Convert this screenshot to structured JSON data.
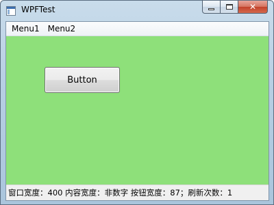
{
  "window": {
    "title": "WPFTest",
    "icon": "app-window-icon",
    "controls": {
      "minimize_icon": "minimize-icon",
      "maximize_icon": "maximize-icon",
      "close_label": "✕"
    }
  },
  "menu": {
    "items": [
      {
        "label": "Menu1"
      },
      {
        "label": "Menu2"
      }
    ]
  },
  "content": {
    "background": "#8ee07a",
    "button_label": "Button"
  },
  "status": {
    "text": "窗口宽度：400  内容宽度：非数字  按钮宽度：87；刷新次数：1"
  }
}
